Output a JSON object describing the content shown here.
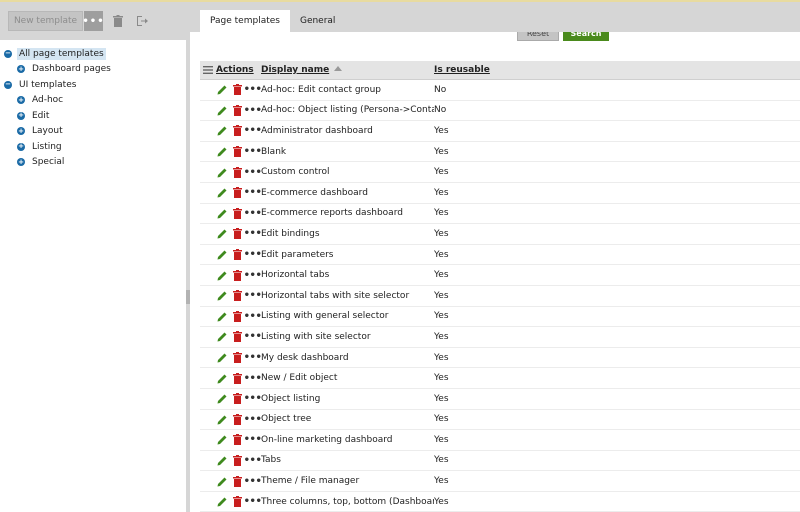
{
  "toolbar": {
    "new_template_label": "New template",
    "more_label": "•••",
    "delete_icon": "trash-icon",
    "export_icon": "export-icon"
  },
  "tree": {
    "items": [
      {
        "label": "All page templates",
        "level": 0,
        "toggle": "−",
        "selected": true
      },
      {
        "label": "Dashboard pages",
        "level": 1,
        "toggle": "+",
        "selected": false
      },
      {
        "label": "UI templates",
        "level": 0,
        "toggle": "−",
        "selected": false
      },
      {
        "label": "Ad-hoc",
        "level": 1,
        "toggle": "+",
        "selected": false
      },
      {
        "label": "Edit",
        "level": 1,
        "toggle": "+",
        "selected": false
      },
      {
        "label": "Layout",
        "level": 1,
        "toggle": "+",
        "selected": false
      },
      {
        "label": "Listing",
        "level": 1,
        "toggle": "+",
        "selected": false
      },
      {
        "label": "Special",
        "level": 1,
        "toggle": "+",
        "selected": false
      }
    ]
  },
  "tabs": [
    {
      "label": "Page templates",
      "active": true
    },
    {
      "label": "General",
      "active": false
    }
  ],
  "filter": {
    "reset_label": "Reset",
    "search_label": "Search"
  },
  "grid": {
    "headers": {
      "actions": "Actions",
      "display_name": "Display name",
      "is_reusable": "Is reusable"
    },
    "rows": [
      {
        "name": "Ad-hoc: Edit contact group",
        "reusable": "No"
      },
      {
        "name": "Ad-hoc: Object listing (Persona->Contacts)",
        "reusable": "No"
      },
      {
        "name": "Administrator dashboard",
        "reusable": "Yes"
      },
      {
        "name": "Blank",
        "reusable": "Yes"
      },
      {
        "name": "Custom control",
        "reusable": "Yes"
      },
      {
        "name": "E-commerce dashboard",
        "reusable": "Yes"
      },
      {
        "name": "E-commerce reports dashboard",
        "reusable": "Yes"
      },
      {
        "name": "Edit bindings",
        "reusable": "Yes"
      },
      {
        "name": "Edit parameters",
        "reusable": "Yes"
      },
      {
        "name": "Horizontal tabs",
        "reusable": "Yes"
      },
      {
        "name": "Horizontal tabs with site selector",
        "reusable": "Yes"
      },
      {
        "name": "Listing with general selector",
        "reusable": "Yes"
      },
      {
        "name": "Listing with site selector",
        "reusable": "Yes"
      },
      {
        "name": "My desk dashboard",
        "reusable": "Yes"
      },
      {
        "name": "New / Edit object",
        "reusable": "Yes"
      },
      {
        "name": "Object listing",
        "reusable": "Yes"
      },
      {
        "name": "Object tree",
        "reusable": "Yes"
      },
      {
        "name": "On-line marketing dashboard",
        "reusable": "Yes"
      },
      {
        "name": "Tabs",
        "reusable": "Yes"
      },
      {
        "name": "Theme / File manager",
        "reusable": "Yes"
      },
      {
        "name": "Three columns, top, bottom (Dashboard)",
        "reusable": "Yes"
      }
    ]
  },
  "colors": {
    "yes": "#3a9a14",
    "no": "#cc1f1f",
    "edit_icon": "#3f8a1e",
    "delete_icon": "#c81e1e",
    "search_button": "#4a8a1c",
    "tree_toggle": "#1a6aa6"
  }
}
